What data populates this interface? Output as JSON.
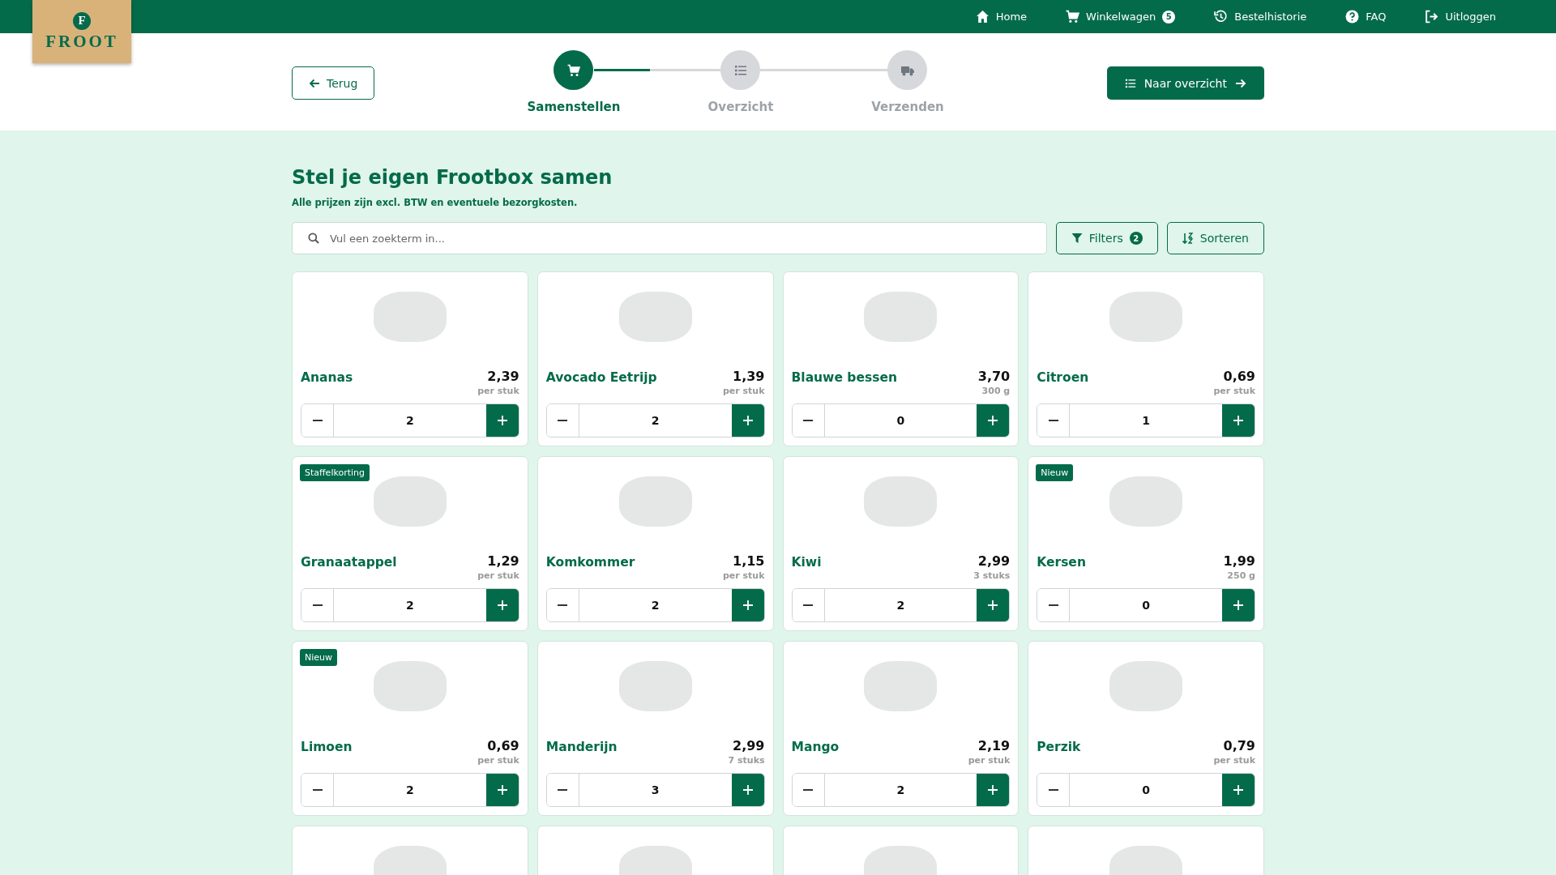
{
  "logo": {
    "letter": "F",
    "name": "FROOT"
  },
  "nav": [
    {
      "kind": "home",
      "label": "Home"
    },
    {
      "kind": "cart",
      "label": "Winkelwagen",
      "count": "5"
    },
    {
      "kind": "history",
      "label": "Bestelhistorie"
    },
    {
      "kind": "help",
      "label": "FAQ"
    },
    {
      "kind": "logout",
      "label": "Uitloggen"
    }
  ],
  "back_button": "Terug",
  "stepper": {
    "level": 0.19,
    "steps": [
      {
        "kind": "cart",
        "label": "Samenstellen",
        "selected": true
      },
      {
        "kind": "list",
        "label": "Overzicht",
        "selected": false
      },
      {
        "kind": "truck",
        "label": "Verzenden",
        "selected": false
      }
    ]
  },
  "next_button": "Naar overzicht",
  "title": "Stel je eigen Frootbox samen",
  "subtitle": "Alle prijzen zijn excl. BTW en eventuele bezorgkosten.",
  "search": {
    "placeholder": "Vul een zoekterm in..."
  },
  "filters_button": {
    "label": "Filters",
    "count": "2"
  },
  "sort_button": "Sorteren",
  "products": [
    {
      "kind": "full",
      "name": "Ananas",
      "price": "2,39",
      "unit": "per stuk",
      "quantity": "2"
    },
    {
      "kind": "full",
      "name": "Avocado Eetrijp",
      "price": "1,39",
      "unit": "per stuk",
      "quantity": "2"
    },
    {
      "kind": "full",
      "name": "Blauwe bessen",
      "price": "3,70",
      "unit": "300 g",
      "quantity": "0"
    },
    {
      "kind": "full",
      "name": "Citroen",
      "price": "0,69",
      "unit": "per stuk",
      "quantity": "1"
    },
    {
      "kind": "full",
      "badge": "Staffelkorting",
      "name": "Granaatappel",
      "price": "1,29",
      "unit": "per stuk",
      "quantity": "2"
    },
    {
      "kind": "full",
      "name": "Komkommer",
      "price": "1,15",
      "unit": "per stuk",
      "quantity": "2"
    },
    {
      "kind": "full",
      "name": "Kiwi",
      "price": "2,99",
      "unit": "3 stuks",
      "quantity": "2"
    },
    {
      "kind": "full",
      "badge": "Nieuw",
      "name": "Kersen",
      "price": "1,99",
      "unit": "250 g",
      "quantity": "0"
    },
    {
      "kind": "full",
      "badge": "Nieuw",
      "name": "Limoen",
      "price": "0,69",
      "unit": "per stuk",
      "quantity": "2"
    },
    {
      "kind": "full",
      "name": "Manderijn",
      "price": "2,99",
      "unit": "7 stuks",
      "quantity": "3"
    },
    {
      "kind": "full",
      "name": "Mango",
      "price": "2,19",
      "unit": "per stuk",
      "quantity": "2"
    },
    {
      "kind": "full",
      "name": "Perzik",
      "price": "0,79",
      "unit": "per stuk",
      "quantity": "0"
    },
    {
      "kind": "partial"
    },
    {
      "kind": "partial"
    },
    {
      "kind": "partial"
    },
    {
      "kind": "partial"
    }
  ]
}
